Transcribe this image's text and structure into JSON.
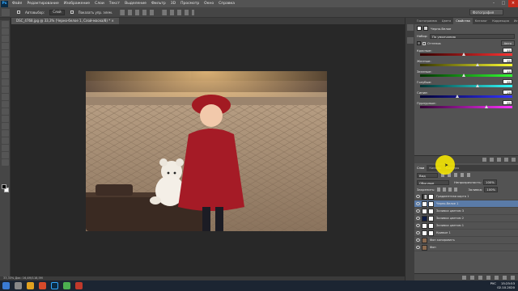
{
  "app": {
    "logo": "Ps"
  },
  "menu": [
    "Файл",
    "Редактирование",
    "Изображение",
    "Слои",
    "Текст",
    "Выделение",
    "Фильтр",
    "3D",
    "Просмотр",
    "Окно",
    "Справка"
  ],
  "options": {
    "autoselect": "Автовыбор:",
    "autoselect_value": "Слой",
    "show_controls": "Показать упр. элем.",
    "workspace": "Фотография"
  },
  "document": {
    "tab_title": "DSC_4768.jpg @ 33,3% (Черно-белое 1, Слой-маска/8) *",
    "status": "33,33%   Док: 16,4M/118,5M"
  },
  "properties": {
    "tabs": [
      "Гистограмма",
      "Цвета",
      "Свойства",
      "Каталог",
      "Коррекция",
      "История"
    ],
    "title": "Черно-белое",
    "preset_label": "Набор:",
    "preset_value": "По умолчанию",
    "tint_label": "Оттенок",
    "auto_label": "Авто",
    "sliders": [
      {
        "label": "Красные:",
        "value": "40"
      },
      {
        "label": "Желтые:",
        "value": "60"
      },
      {
        "label": "Зеленые:",
        "value": "40"
      },
      {
        "label": "Голубые:",
        "value": "60"
      },
      {
        "label": "Синие:",
        "value": "20"
      },
      {
        "label": "Пурпурные:",
        "value": "80"
      }
    ],
    "slider_levels": [
      0.47,
      0.62,
      0.47,
      0.62,
      0.4,
      0.72
    ],
    "slider_colors": [
      "linear-gradient(90deg,#300,#f33)",
      "linear-gradient(90deg,#330,#ff3)",
      "linear-gradient(90deg,#030,#3f3)",
      "linear-gradient(90deg,#033,#3ff)",
      "linear-gradient(90deg,#003,#33f)",
      "linear-gradient(90deg,#303,#f3f)"
    ]
  },
  "layers": {
    "tabs": [
      "Слои",
      "Каналы",
      "Контуры"
    ],
    "kind": "Вид",
    "blend": "Обычные",
    "opacity_label": "Непрозрачность:",
    "opacity": "100%",
    "lock_label": "Закрепить:",
    "fill_label": "Заливка:",
    "fill": "100%",
    "items": [
      {
        "name": "Градиентная карта 1",
        "type": "grad"
      },
      {
        "name": "Черно-белое 1",
        "type": "bw",
        "selected": true
      },
      {
        "name": "Заливка цветом 3",
        "type": "fill"
      },
      {
        "name": "Заливка цветом 2",
        "type": "navy"
      },
      {
        "name": "Заливка цветом 1",
        "type": "fill"
      },
      {
        "name": "Кривые 1",
        "type": "curve"
      },
      {
        "name": "Фон копировать",
        "type": "photo"
      },
      {
        "name": "Фон",
        "type": "photo"
      }
    ]
  },
  "taskbar": {
    "lang": "РУС",
    "time": "15:25:53",
    "date": "02.10.2020"
  }
}
